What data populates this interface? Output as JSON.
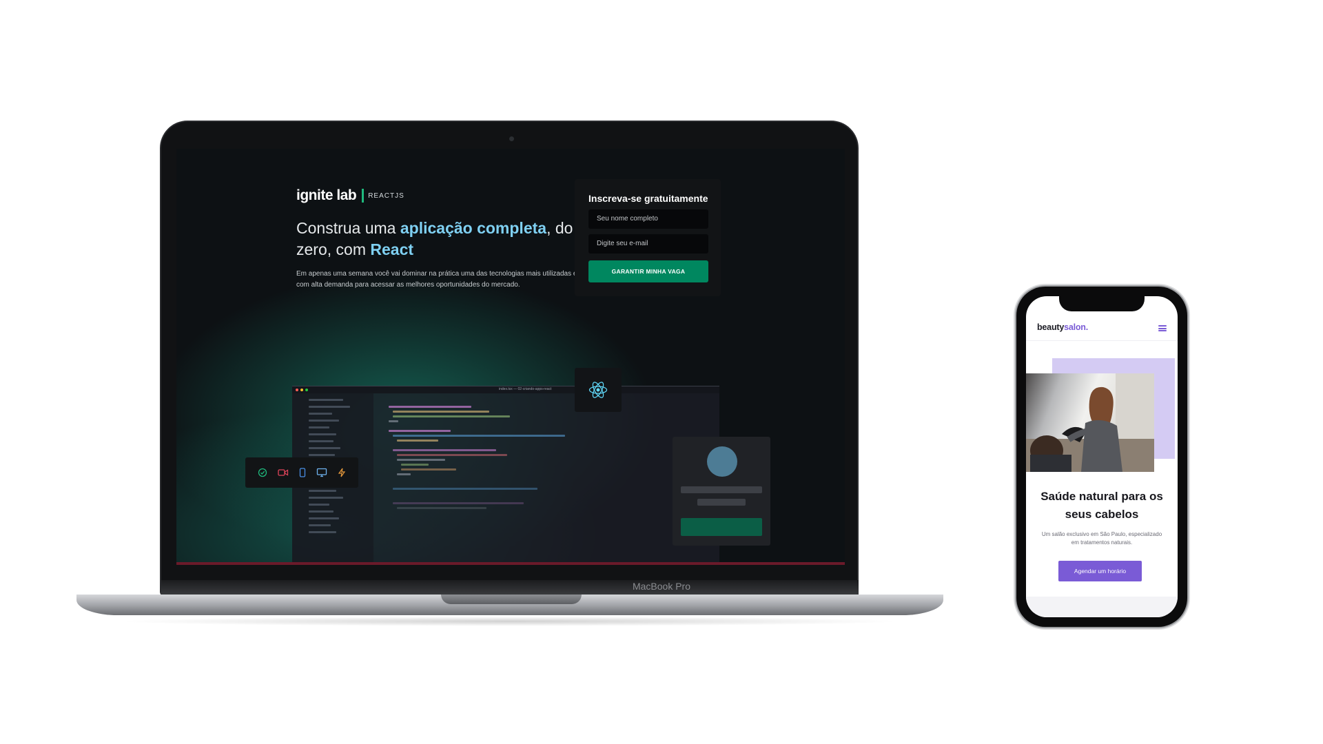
{
  "laptop": {
    "brand_label": "MacBook Pro",
    "site": {
      "logo_main": "ignite lab",
      "logo_sub": "REACTJS",
      "headline_part1": "Construa uma ",
      "headline_highlight1": "aplicação completa",
      "headline_part2": ", do zero, com ",
      "headline_highlight2": "React",
      "description": "Em apenas uma semana você vai dominar na prática uma das tecnologias mais utilizadas e com alta demanda para acessar as melhores oportunidades do mercado.",
      "signup": {
        "title": "Inscreva-se gratuitamente",
        "name_placeholder": "Seu nome completo",
        "email_placeholder": "Digite seu e-mail",
        "button_label": "GARANTIR MINHA VAGA"
      },
      "code_window_title": "index.tsx — 02-criando-apps-react",
      "toolbar_icons": [
        "check-circle-icon",
        "video-icon",
        "phone-icon",
        "monitor-icon",
        "lightning-icon"
      ]
    },
    "colors": {
      "accent_green": "#00875f",
      "highlight_blue": "#7fd0f2"
    }
  },
  "phone": {
    "brand_main": "beauty",
    "brand_accent": "salon.",
    "hero_title": "Saúde natural para os seus cabelos",
    "hero_subtitle": "Um salão exclusivo em São Paulo, especializado em tratamentos naturais.",
    "cta_label": "Agendar um horário",
    "colors": {
      "accent_purple": "#7a5bd6",
      "hero_bg": "#d4cbf3"
    }
  }
}
